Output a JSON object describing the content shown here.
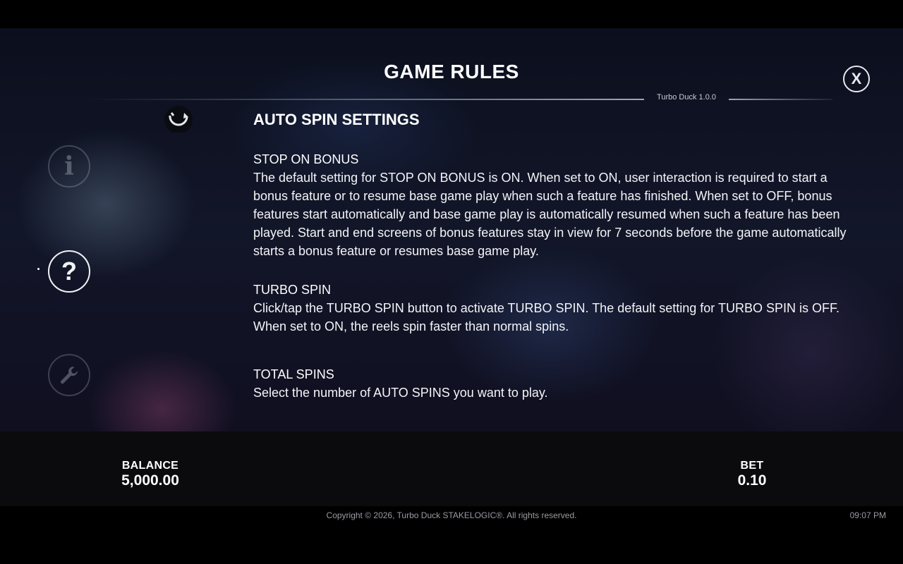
{
  "header": {
    "title": "GAME RULES",
    "version": "Turbo Duck 1.0.0",
    "close_label": "X"
  },
  "sidebar": {
    "items": [
      {
        "name": "info",
        "glyph": "i"
      },
      {
        "name": "help",
        "glyph": "?"
      },
      {
        "name": "settings",
        "glyph": "wrench-icon"
      }
    ]
  },
  "content": {
    "heading": "AUTO SPIN SETTINGS",
    "sections": [
      {
        "title": "STOP ON BONUS",
        "text": "The default setting for STOP ON BONUS is ON. When set to ON, user interaction is required to start a bonus feature or to resume base game play when such a feature has finished. When set to OFF, bonus features start automatically and base game play is automatically resumed when such a feature has been played. Start and end screens of bonus features stay in view for 7 seconds before the game automatically starts a bonus feature or resumes base game play."
      },
      {
        "title": "TURBO SPIN",
        "text": "Click/tap the TURBO SPIN button to activate TURBO SPIN. The default setting for TURBO SPIN is OFF. When set to ON, the reels spin faster than normal spins."
      },
      {
        "title": "TOTAL SPINS",
        "text": "Select the number of AUTO SPINS you want to play."
      }
    ]
  },
  "footer": {
    "balance_label": "BALANCE",
    "balance_value": "5,000.00",
    "bet_label": "BET",
    "bet_value": "0.10",
    "copyright": "Copyright © 2026, Turbo Duck STAKELOGIC®. All rights reserved.",
    "clock": "09:07 PM"
  },
  "colors": {
    "text": "#ffffff",
    "muted": "#9a9aa2",
    "footer_bg": "#0b0b0e"
  }
}
